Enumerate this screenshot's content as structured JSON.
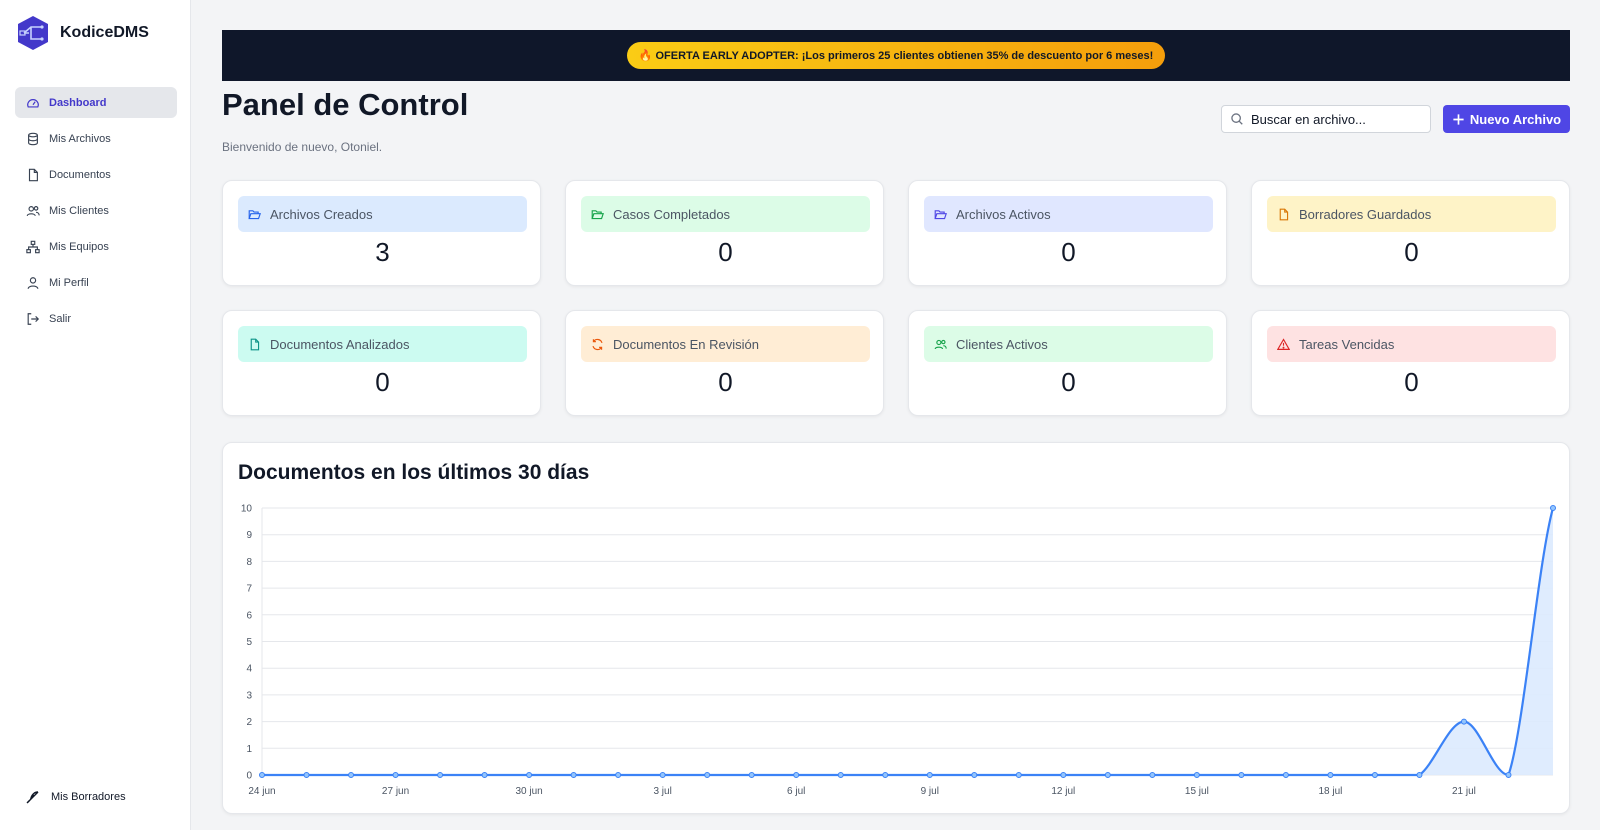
{
  "brand": {
    "name": "KodiceDMS"
  },
  "sidebar": {
    "items": [
      {
        "label": "Dashboard",
        "icon": "gauge-icon",
        "active": true
      },
      {
        "label": "Mis Archivos",
        "icon": "database-icon",
        "active": false
      },
      {
        "label": "Documentos",
        "icon": "file-icon",
        "active": false
      },
      {
        "label": "Mis Clientes",
        "icon": "users-icon",
        "active": false
      },
      {
        "label": "Mis Equipos",
        "icon": "network-icon",
        "active": false
      },
      {
        "label": "Mi Perfil",
        "icon": "user-icon",
        "active": false
      },
      {
        "label": "Salir",
        "icon": "logout-icon",
        "active": false
      }
    ],
    "drafts_label": "Mis Borradores"
  },
  "banner": {
    "text": "🔥 OFERTA EARLY ADOPTER: ¡Los primeros 25 clientes obtienen 35% de descuento por 6 meses!"
  },
  "header": {
    "title": "Panel de Control",
    "subtitle": "Bienvenido de nuevo, Otoniel.",
    "search_placeholder": "Buscar en archivo...",
    "new_button_label": "Nuevo Archivo"
  },
  "stats": [
    {
      "label": "Archivos Creados",
      "value": "3",
      "icon": "folder-open-icon",
      "color": "#dbeafe",
      "icon_color": "#2563eb"
    },
    {
      "label": "Casos Completados",
      "value": "0",
      "icon": "folder-open-icon",
      "color": "#dcfce7",
      "icon_color": "#16a34a"
    },
    {
      "label": "Archivos Activos",
      "value": "0",
      "icon": "folder-open-icon",
      "color": "#e0e7ff",
      "icon_color": "#4f46e5"
    },
    {
      "label": "Borradores Guardados",
      "value": "0",
      "icon": "file-icon",
      "color": "#fef3c7",
      "icon_color": "#d97706"
    },
    {
      "label": "Documentos Analizados",
      "value": "0",
      "icon": "file-icon",
      "color": "#ccfbf1",
      "icon_color": "#0d9488"
    },
    {
      "label": "Documentos En Revisión",
      "value": "0",
      "icon": "refresh-icon",
      "color": "#ffedd5",
      "icon_color": "#ea580c"
    },
    {
      "label": "Clientes Activos",
      "value": "0",
      "icon": "users-icon",
      "color": "#dcfce7",
      "icon_color": "#16a34a"
    },
    {
      "label": "Tareas Vencidas",
      "value": "0",
      "icon": "warning-icon",
      "color": "#fee2e2",
      "icon_color": "#dc2626"
    }
  ],
  "chart_data": {
    "type": "area",
    "title": "Documentos en los últimos 30 días",
    "x": [
      "24 jun",
      "25 jun",
      "26 jun",
      "27 jun",
      "28 jun",
      "29 jun",
      "30 jun",
      "1 jul",
      "2 jul",
      "3 jul",
      "4 jul",
      "5 jul",
      "6 jul",
      "7 jul",
      "8 jul",
      "9 jul",
      "10 jul",
      "11 jul",
      "12 jul",
      "13 jul",
      "14 jul",
      "15 jul",
      "16 jul",
      "17 jul",
      "18 jul",
      "19 jul",
      "20 jul",
      "21 jul",
      "22 jul",
      "23 jul"
    ],
    "x_tick_labels": [
      "24 jun",
      "27 jun",
      "30 jun",
      "3 jul",
      "6 jul",
      "9 jul",
      "12 jul",
      "15 jul",
      "18 jul",
      "21 jul"
    ],
    "series": [
      {
        "values": [
          0,
          0,
          0,
          0,
          0,
          0,
          0,
          0,
          0,
          0,
          0,
          0,
          0,
          0,
          0,
          0,
          0,
          0,
          0,
          0,
          0,
          0,
          0,
          0,
          0,
          0,
          0,
          2,
          0,
          10
        ]
      }
    ],
    "ylim": [
      0,
      10
    ],
    "yticks": [
      0,
      1,
      2,
      3,
      4,
      5,
      6,
      7,
      8,
      9,
      10
    ],
    "grid": true,
    "colors": {
      "line": "#3b82f6",
      "fill": "#dbeafe"
    }
  }
}
